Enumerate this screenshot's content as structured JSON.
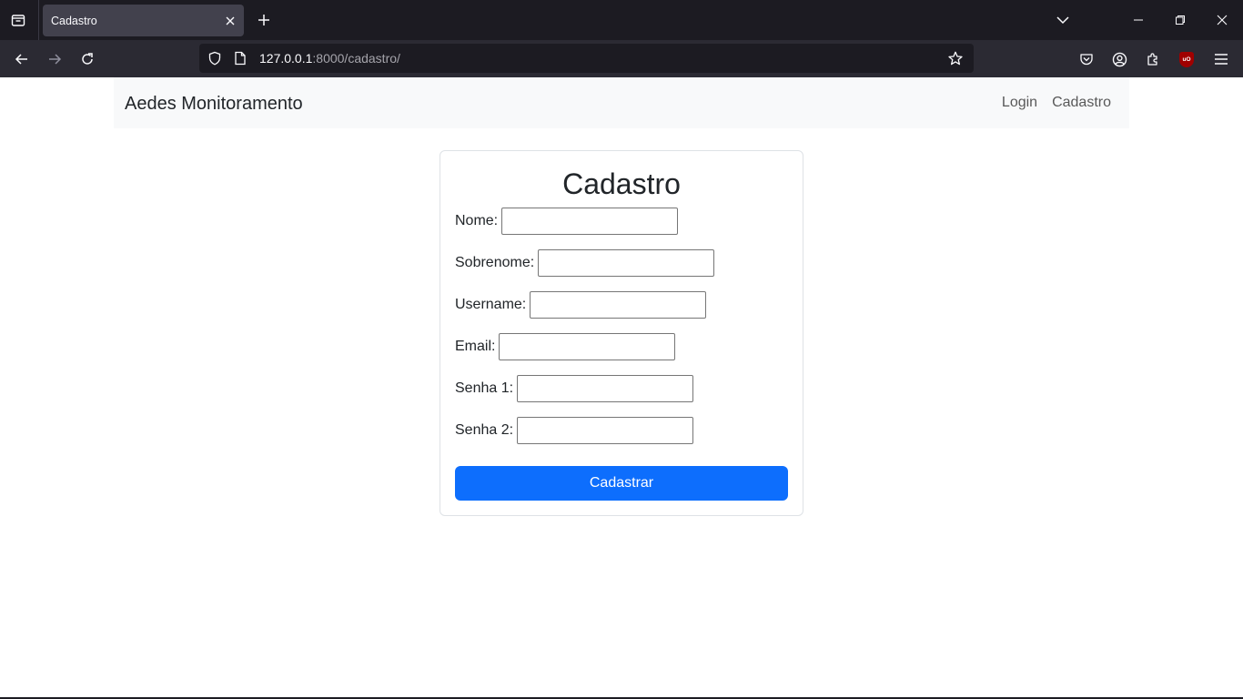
{
  "browser": {
    "tab_title": "Cadastro",
    "url_host": "127.0.0.1",
    "url_path": ":8000/cadastro/"
  },
  "site": {
    "brand": "Aedes Monitoramento",
    "links": [
      "Login",
      "Cadastro"
    ]
  },
  "form": {
    "title": "Cadastro",
    "fields": [
      {
        "label": "Nome:",
        "value": ""
      },
      {
        "label": "Sobrenome:",
        "value": ""
      },
      {
        "label": "Username:",
        "value": ""
      },
      {
        "label": "Email:",
        "value": ""
      },
      {
        "label": "Senha 1:",
        "value": ""
      },
      {
        "label": "Senha 2:",
        "value": ""
      }
    ],
    "submit_label": "Cadastrar"
  },
  "colors": {
    "primary_button": "#0d6efd",
    "navbar_bg": "#f8f9fa",
    "chrome_bg": "#1c1b22"
  },
  "icons": [
    "tabs-list-icon",
    "close-icon",
    "plus-icon",
    "chevron-down-icon",
    "minimize-icon",
    "restore-icon",
    "window-close-icon",
    "back-icon",
    "forward-icon",
    "reload-icon",
    "shield-icon",
    "page-icon",
    "star-icon",
    "pocket-icon",
    "account-icon",
    "extensions-icon",
    "ublock-icon",
    "hamburger-menu-icon"
  ]
}
